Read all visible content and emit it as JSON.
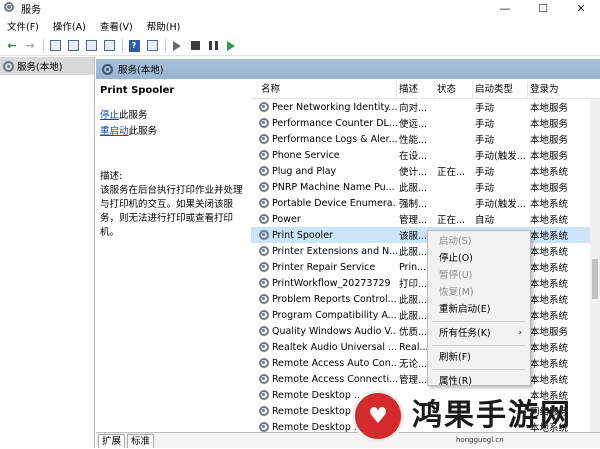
{
  "window": {
    "title": "服务",
    "minimize": "—",
    "maximize": "☐",
    "close": "✕"
  },
  "menubar": {
    "items": [
      "文件(F)",
      "操作(A)",
      "查看(V)",
      "帮助(H)"
    ]
  },
  "tree": {
    "root_label": "服务(本地)"
  },
  "header": {
    "title": "服务(本地)"
  },
  "detail": {
    "service_name": "Print Spooler",
    "stop_link": "停止",
    "stop_suffix": "此服务",
    "restart_link": "重启动",
    "restart_suffix": "此服务",
    "desc_label": "描述:",
    "description": "该服务在后台执行打印作业并处理与打印机的交互。如果关闭该服务，则无法进行打印或查看打印机。"
  },
  "columns": [
    "名称",
    "描述",
    "状态",
    "启动类型",
    "登录为"
  ],
  "rows": [
    {
      "name": "Peer Networking Identity...",
      "desc": "向对...",
      "status": "",
      "start": "手动",
      "logon": "本地服务"
    },
    {
      "name": "Performance Counter DL...",
      "desc": "使远...",
      "status": "",
      "start": "手动",
      "logon": "本地服务"
    },
    {
      "name": "Performance Logs & Aler...",
      "desc": "性能...",
      "status": "",
      "start": "手动",
      "logon": "本地服务"
    },
    {
      "name": "Phone Service",
      "desc": "在设...",
      "status": "",
      "start": "手动(触发...",
      "logon": "本地服务"
    },
    {
      "name": "Plug and Play",
      "desc": "使计...",
      "status": "正在...",
      "start": "手动",
      "logon": "本地系统"
    },
    {
      "name": "PNRP Machine Name Pu...",
      "desc": "此服...",
      "status": "",
      "start": "手动",
      "logon": "本地服务"
    },
    {
      "name": "Portable Device Enumera...",
      "desc": "强制...",
      "status": "",
      "start": "手动(触发...",
      "logon": "本地系统"
    },
    {
      "name": "Power",
      "desc": "管理...",
      "status": "正在...",
      "start": "自动",
      "logon": "本地系统"
    },
    {
      "name": "Print Spooler",
      "desc": "该服...",
      "status": "",
      "start": "",
      "logon": "本地系统"
    },
    {
      "name": "Printer Extensions and N...",
      "desc": "此服...",
      "status": "",
      "start": "",
      "logon": "本地系统"
    },
    {
      "name": "Printer Repair Service",
      "desc": "Prin...",
      "status": "",
      "start": "",
      "logon": "本地系统"
    },
    {
      "name": "PrintWorkflow_20273729",
      "desc": "打印...",
      "status": "",
      "start": "",
      "logon": "本地系统"
    },
    {
      "name": "Problem Reports Control...",
      "desc": "此服...",
      "status": "",
      "start": "",
      "logon": "本地系统"
    },
    {
      "name": "Program Compatibility A...",
      "desc": "此服...",
      "status": "",
      "start": "",
      "logon": "本地系统"
    },
    {
      "name": "Quality Windows Audio V...",
      "desc": "优质...",
      "status": "",
      "start": "",
      "logon": "本地服务"
    },
    {
      "name": "Realtek Audio Universal ...",
      "desc": "Real...",
      "status": "",
      "start": "",
      "logon": "本地系统"
    },
    {
      "name": "Remote Access Auto Con...",
      "desc": "无论...",
      "status": "",
      "start": "",
      "logon": "本地系统"
    },
    {
      "name": "Remote Access Connecti...",
      "desc": "管理...",
      "status": "",
      "start": "",
      "logon": "本地系统"
    },
    {
      "name": "Remote Desktop ...",
      "desc": "",
      "status": "",
      "start": "",
      "logon": "本地系统"
    },
    {
      "name": "Remote Desktop ...",
      "desc": "",
      "status": "",
      "start": "",
      "logon": "网络服务"
    },
    {
      "name": "Remote Desktop ...",
      "desc": "",
      "status": "",
      "start": "",
      "logon": "本地系统"
    }
  ],
  "context_menu": {
    "items": [
      {
        "label": "启动(S)",
        "disabled": true
      },
      {
        "label": "停止(O)",
        "disabled": false
      },
      {
        "label": "暂停(U)",
        "disabled": true
      },
      {
        "label": "恢复(M)",
        "disabled": true
      },
      {
        "label": "重新启动(E)",
        "disabled": false
      },
      {
        "label": "所有任务(K)",
        "disabled": false,
        "submenu": true
      },
      {
        "label": "刷新(F)",
        "disabled": false
      },
      {
        "label": "属性(R)",
        "disabled": false
      }
    ]
  },
  "bottom_tabs": [
    "扩展",
    "标准"
  ],
  "watermark": {
    "text": "鸿果手游网",
    "url": "hongguogl.cn"
  },
  "colors": {
    "selection": "#cce4f7",
    "header_band": "#a9c1da",
    "link": "#0a4fb8"
  }
}
